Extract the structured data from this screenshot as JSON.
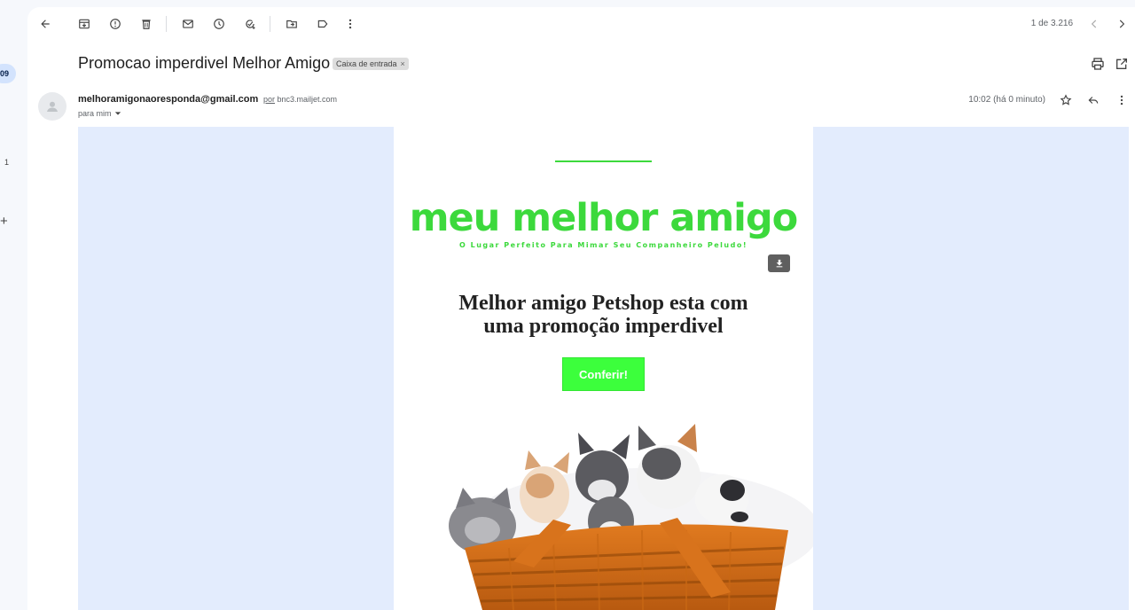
{
  "rail": {
    "badge": "09",
    "count": "1",
    "plus": "+"
  },
  "toolbar": {
    "pager": "1 de 3.216",
    "icons": [
      "back-icon",
      "archive-icon",
      "report-spam-icon",
      "delete-icon",
      "mark-unread-icon",
      "snooze-icon",
      "add-task-icon",
      "move-to-icon",
      "label-icon",
      "more-vert-icon",
      "prev-icon",
      "next-icon"
    ]
  },
  "subject": {
    "title": "Promocao imperdivel Melhor Amigo",
    "label": "Caixa de entrada",
    "label_close": "×"
  },
  "sender": {
    "email": "melhoramigonaoresponda@gmail.com",
    "via_prefix": "por",
    "via_domain": "bnc3.mailjet.com",
    "recipient": "para mim",
    "time": "10:02 (há 0 minuto)"
  },
  "email": {
    "logo": "meu melhor amigo",
    "tagline": "O Lugar Perfeito Para Mimar Seu Companheiro Peludo!",
    "headline_line1": "Melhor amigo Petshop esta com",
    "headline_line2": "uma promoção imperdivel",
    "cta": "Conferir!"
  },
  "colors": {
    "brand_green": "#3cd93c",
    "cta_green": "#3cff3c",
    "email_background": "#e3ecfd"
  }
}
